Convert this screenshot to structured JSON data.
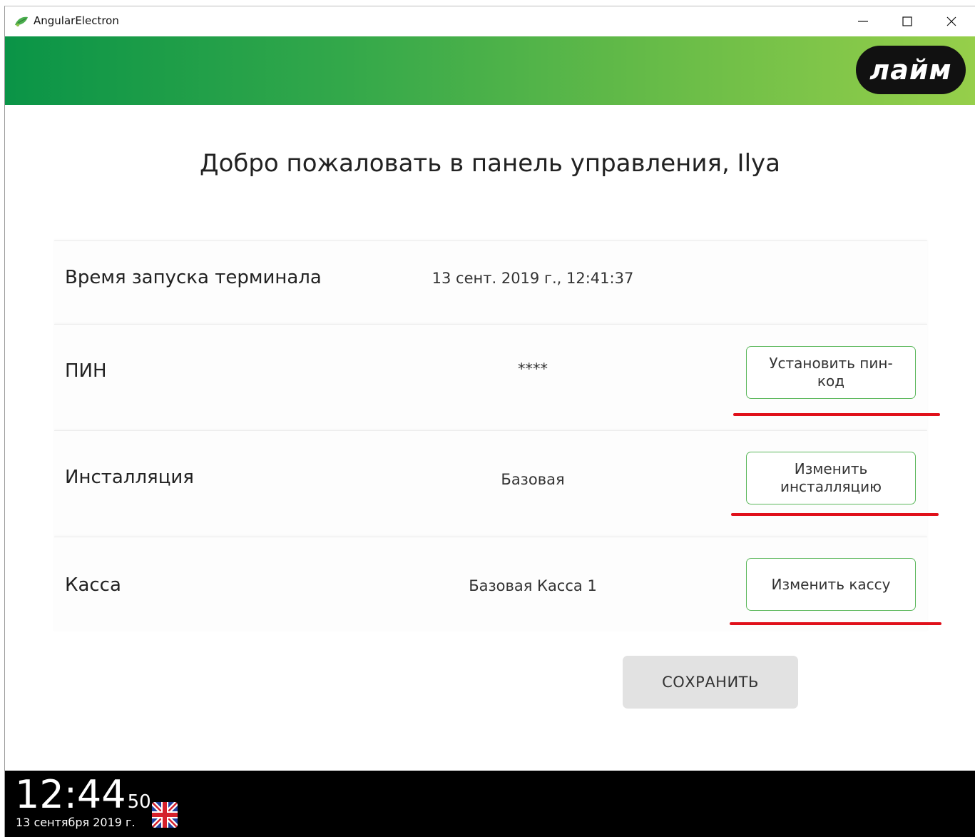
{
  "window": {
    "title": "AngularElectron",
    "icon": "app-leaf-icon"
  },
  "header": {
    "logo_text": "лайм",
    "brand_gradient": [
      "#0a9447",
      "#96cf4a"
    ]
  },
  "main": {
    "welcome": "Добро пожаловать в панель управления, Ilya",
    "rows": [
      {
        "label": "Время запуска терминала",
        "value": "13 сент. 2019 г., 12:41:37"
      },
      {
        "label": "ПИН",
        "value": "****",
        "button": "Установить пин-код"
      },
      {
        "label": "Инсталляция",
        "value": "Базовая",
        "button": "Изменить инсталляцию"
      },
      {
        "label": "Касса",
        "value": "Базовая Касса 1",
        "button": "Изменить кассу"
      }
    ],
    "save_label": "СОХРАНИТЬ"
  },
  "footer": {
    "time": "12:44",
    "seconds": "50",
    "date": "13 сентября 2019 г.",
    "language_icon": "uk-flag-icon"
  },
  "colors": {
    "accent_border": "#5cb85c",
    "annotation_red": "#e0101a",
    "footer_bg": "#000000"
  }
}
